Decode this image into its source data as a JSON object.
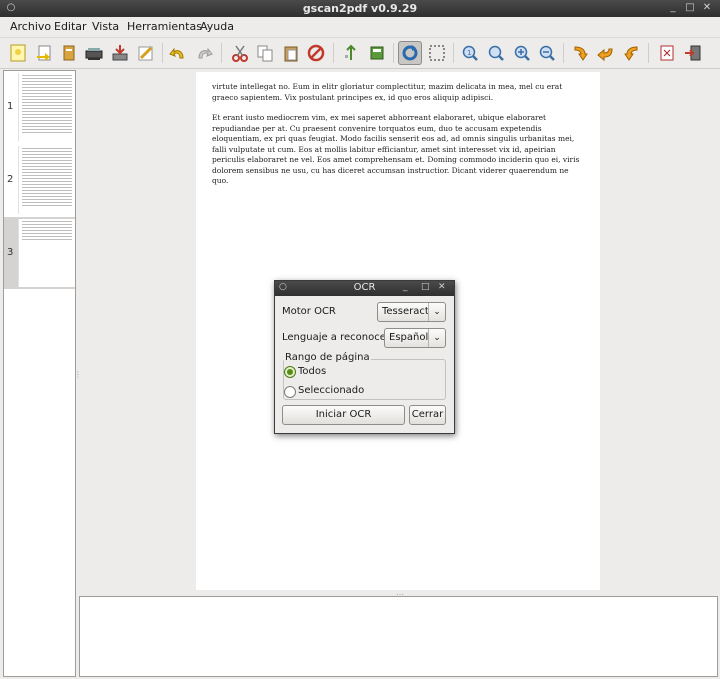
{
  "window": {
    "title": "gscan2pdf v0.9.29"
  },
  "menu": {
    "items": [
      "Archivo",
      "Editar",
      "Vista",
      "Herramientas",
      "Ayuda"
    ]
  },
  "toolbar": {
    "icons": [
      "new-document-icon",
      "open-icon",
      "import-icon",
      "scan-icon",
      "save-icon",
      "email-icon",
      "undo-icon",
      "redo-icon",
      "cut-icon",
      "copy-icon",
      "paste-icon",
      "delete-icon",
      "renumber-icon",
      "select-icon",
      "rotate-icon",
      "crop-select-icon",
      "zoom-100-icon",
      "zoom-fit-icon",
      "zoom-in-icon",
      "zoom-out-icon",
      "rotate-90-icon",
      "rotate-180-icon",
      "rotate-270-icon",
      "print-icon",
      "quit-icon"
    ]
  },
  "thumbnails": [
    {
      "number": "1"
    },
    {
      "number": "2"
    },
    {
      "number": "3"
    }
  ],
  "page": {
    "paragraphs": [
      "virtute intellegat no. Eum in elitr gloriatur complectitur, mazim delicata in mea, mel cu erat graeco sapientem. Vix postulant principes ex, id quo eros aliquip adipisci.",
      "Et erant iusto mediocrem vim, ex mei saperet abhorreant elaboraret, ubique elaboraret repudiandae per at. Cu praesent convenire torquatos eum, duo te accusam expetendis eloquentiam, ex pri quas feugiat. Modo facilis senserit eos ad, ad omnis singulis urbanitas mei, falli vulputate ut cum. Eos at mollis labitur efficiantur, amet sint interesset vix id, apeirian periculis elaboraret ne vel. Eos amet comprehensam et. Doming commodo inciderin quo ei, viris dolorem sensibus ne usu, cu has diceret accumsan instructior. Dicant viderer quaerendum ne quo."
    ]
  },
  "ocr_dialog": {
    "title": "OCR",
    "engine_label": "Motor OCR",
    "engine_value": "Tesseract",
    "language_label": "Lenguaje a reconocer",
    "language_value": "Español",
    "range_label": "Rango de página",
    "range_all": "Todos",
    "range_selected": "Seleccionado",
    "start_button": "Iniciar OCR",
    "close_button": "Cerrar"
  }
}
